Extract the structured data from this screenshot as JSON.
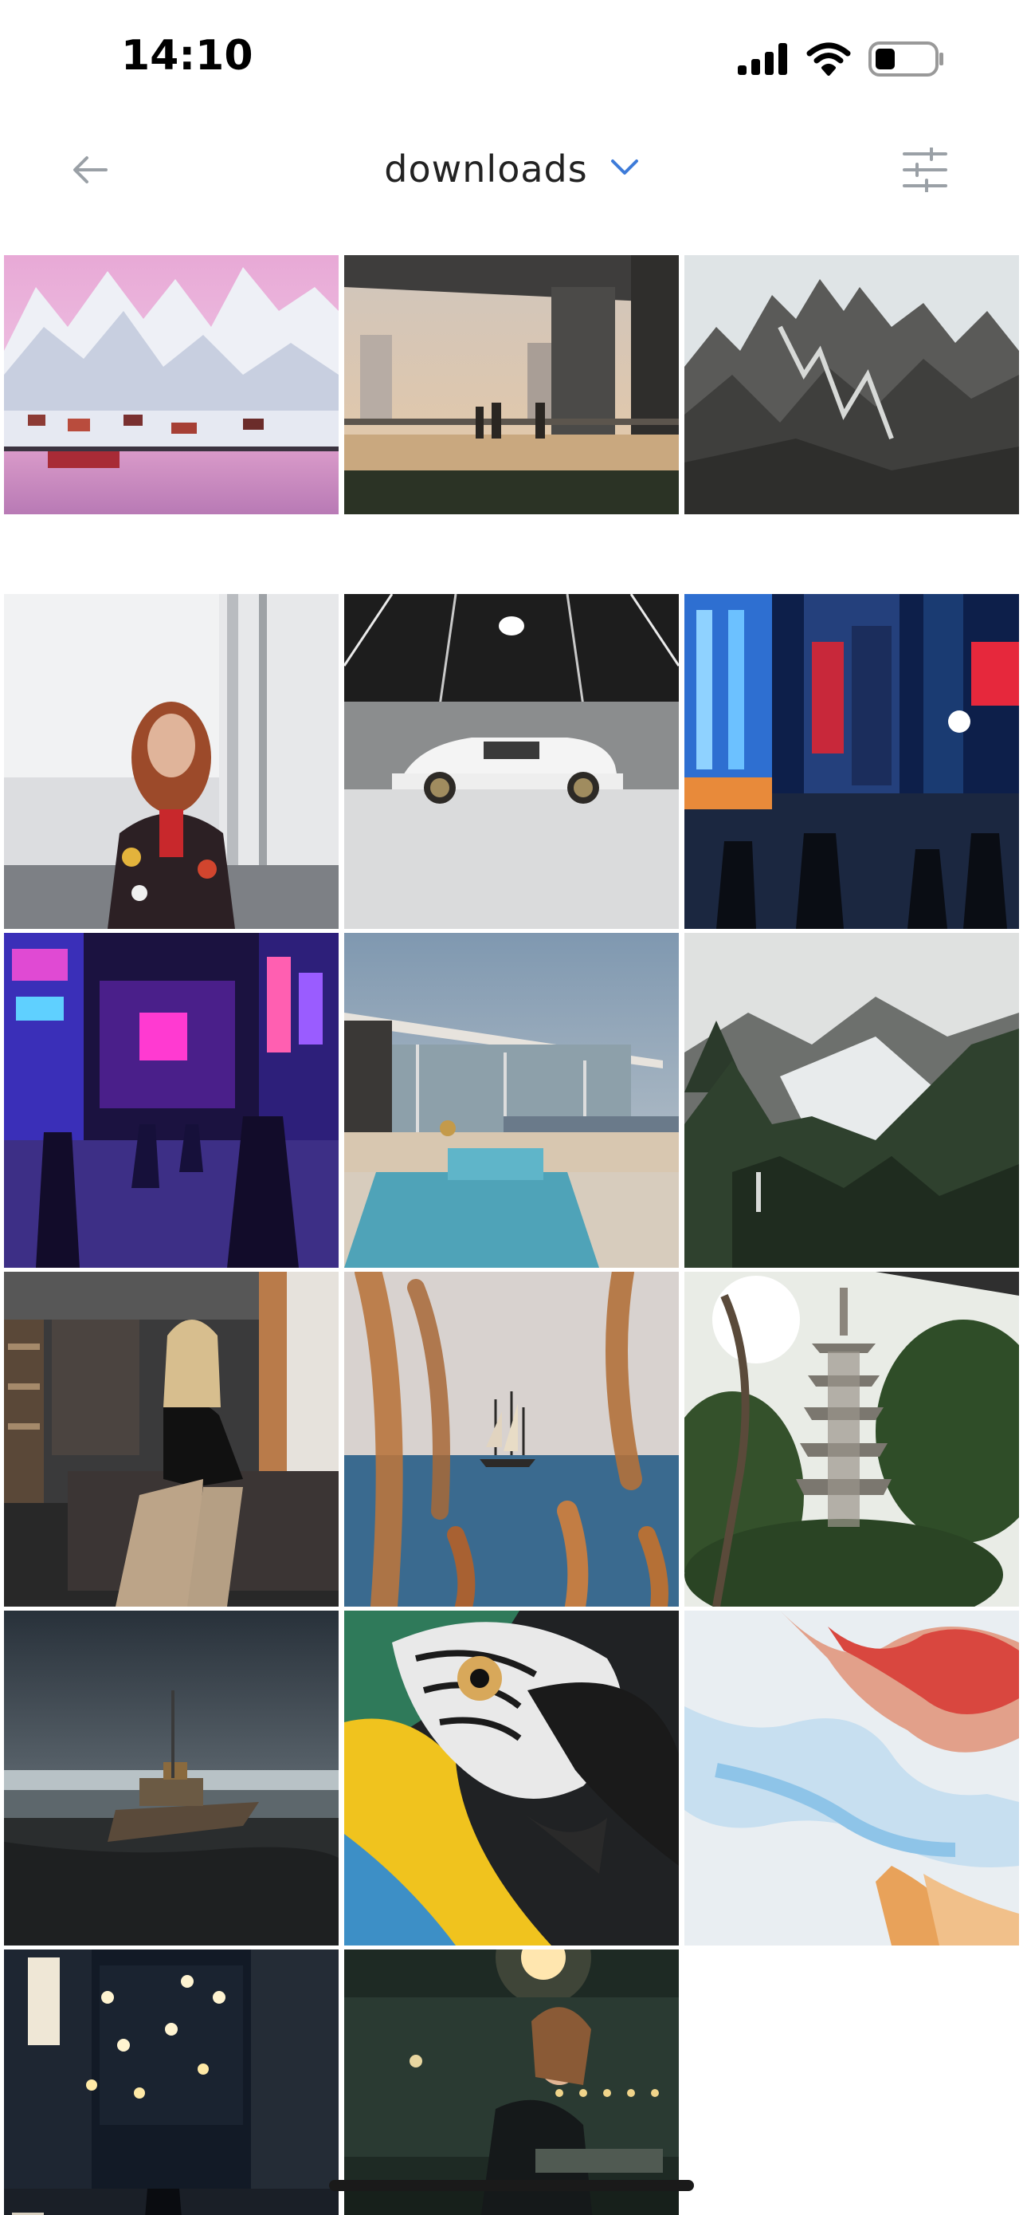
{
  "status_bar": {
    "time": "14:10",
    "icons": [
      "cellular-signal-icon",
      "wifi-icon",
      "battery-icon"
    ]
  },
  "nav": {
    "back_icon": "arrow-left-icon",
    "title": "downloads",
    "dropdown_icon": "chevron-down-icon",
    "filter_icon": "sliders-icon",
    "accent_color": "#3d7bd9"
  },
  "grid": {
    "columns": 3,
    "photos": [
      {
        "subject": "snowy-mountain-harbor-village"
      },
      {
        "subject": "silhouettes-under-bridge-sunset"
      },
      {
        "subject": "jagged-rocky-mountain-peaks"
      },
      {
        "subject": "woman-patch-jacket-white-wall"
      },
      {
        "subject": "white-sports-car-parking-garage"
      },
      {
        "subject": "neon-city-street-night"
      },
      {
        "subject": "purple-neon-alley-crowd"
      },
      {
        "subject": "modern-house-pool-city-view"
      },
      {
        "subject": "misty-forest-snowy-mountain"
      },
      {
        "subject": "woman-sitting-on-sofa"
      },
      {
        "subject": "sailing-ship-through-grass"
      },
      {
        "subject": "pagoda-in-garden"
      },
      {
        "subject": "shipwreck-on-beach"
      },
      {
        "subject": "macaw-parrot-closeup"
      },
      {
        "subject": "fluid-art-marble"
      },
      {
        "subject": "japanese-alley-lanterns"
      },
      {
        "subject": "woman-dark-tunnel-lights"
      }
    ]
  }
}
